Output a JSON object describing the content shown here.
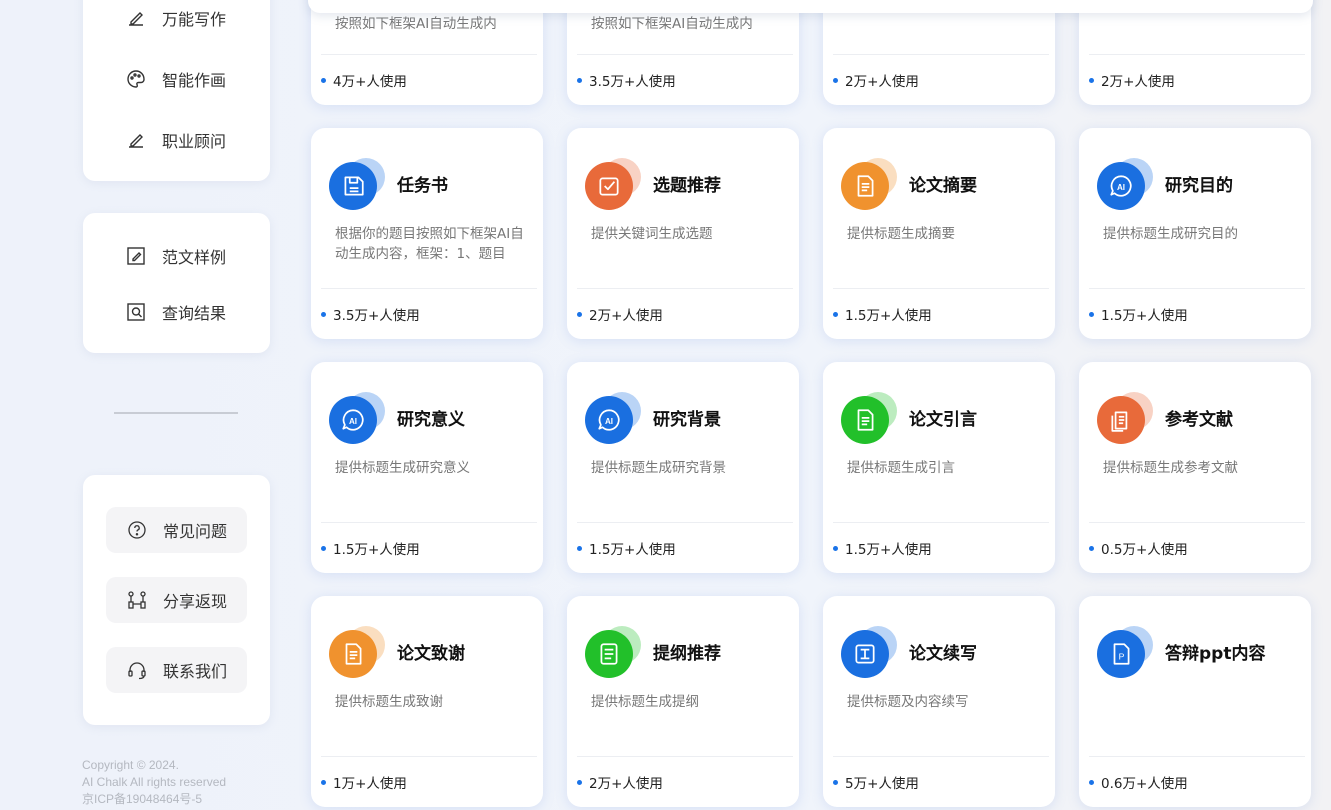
{
  "colors": {
    "blue": "#1a6fe0",
    "orange": "#e86a3a",
    "amber": "#f0922e",
    "green": "#22c02a",
    "dot": "#1a73e8"
  },
  "sidebar": {
    "top_items": [
      {
        "label": "万能写作",
        "icon": "pencil-icon"
      },
      {
        "label": "智能作画",
        "icon": "palette-icon"
      },
      {
        "label": "职业顾问",
        "icon": "pencil-icon"
      }
    ],
    "mid_items": [
      {
        "label": "范文样例",
        "icon": "edit-document-icon"
      },
      {
        "label": "查询结果",
        "icon": "search-document-icon"
      }
    ],
    "bottom_items": [
      {
        "label": "常见问题",
        "icon": "question-icon"
      },
      {
        "label": "分享返现",
        "icon": "share-icon"
      },
      {
        "label": "联系我们",
        "icon": "headset-icon"
      }
    ],
    "copyright": [
      "Copyright © 2024.",
      "AI Chalk All rights reserved",
      "京ICP备19048464号-5"
    ]
  },
  "cards": [
    {
      "title": "",
      "desc": "按照如下框架AI自动生成内",
      "usage": "4万+人使用",
      "color": "blue",
      "icon": "none"
    },
    {
      "title": "",
      "desc": "按照如下框架AI自动生成内",
      "usage": "3.5万+人使用",
      "color": "blue",
      "icon": "none"
    },
    {
      "title": "",
      "desc": "",
      "usage": "2万+人使用",
      "color": "blue",
      "icon": "none"
    },
    {
      "title": "",
      "desc": "",
      "usage": "2万+人使用",
      "color": "blue",
      "icon": "none"
    },
    {
      "title": "任务书",
      "desc": "根据你的题目按照如下框架AI自动生成内容，框架：1、题目",
      "usage": "3.5万+人使用",
      "color": "blue",
      "icon": "floppy-icon"
    },
    {
      "title": "选题推荐",
      "desc": "提供关键词生成选题",
      "usage": "2万+人使用",
      "color": "orange",
      "icon": "checkbox-icon"
    },
    {
      "title": "论文摘要",
      "desc": "提供标题生成摘要",
      "usage": "1.5万+人使用",
      "color": "amber",
      "icon": "document-icon"
    },
    {
      "title": "研究目的",
      "desc": "提供标题生成研究目的",
      "usage": "1.5万+人使用",
      "color": "blue",
      "icon": "ai-bubble-icon"
    },
    {
      "title": "研究意义",
      "desc": "提供标题生成研究意义",
      "usage": "1.5万+人使用",
      "color": "blue",
      "icon": "ai-bubble-icon"
    },
    {
      "title": "研究背景",
      "desc": "提供标题生成研究背景",
      "usage": "1.5万+人使用",
      "color": "blue",
      "icon": "ai-bubble-icon"
    },
    {
      "title": "论文引言",
      "desc": "提供标题生成引言",
      "usage": "1.5万+人使用",
      "color": "green",
      "icon": "document-icon"
    },
    {
      "title": "参考文献",
      "desc": "提供标题生成参考文献",
      "usage": "0.5万+人使用",
      "color": "orange",
      "icon": "papers-icon"
    },
    {
      "title": "论文致谢",
      "desc": "提供标题生成致谢",
      "usage": "1万+人使用",
      "color": "amber",
      "icon": "document-icon"
    },
    {
      "title": "提纲推荐",
      "desc": "提供标题生成提纲",
      "usage": "2万+人使用",
      "color": "green",
      "icon": "list-icon"
    },
    {
      "title": "论文续写",
      "desc": "提供标题及内容续写",
      "usage": "5万+人使用",
      "color": "blue",
      "icon": "text-edit-icon"
    },
    {
      "title": "答辩ppt内容",
      "desc": "",
      "usage": "0.6万+人使用",
      "color": "blue",
      "icon": "ppt-icon"
    }
  ]
}
